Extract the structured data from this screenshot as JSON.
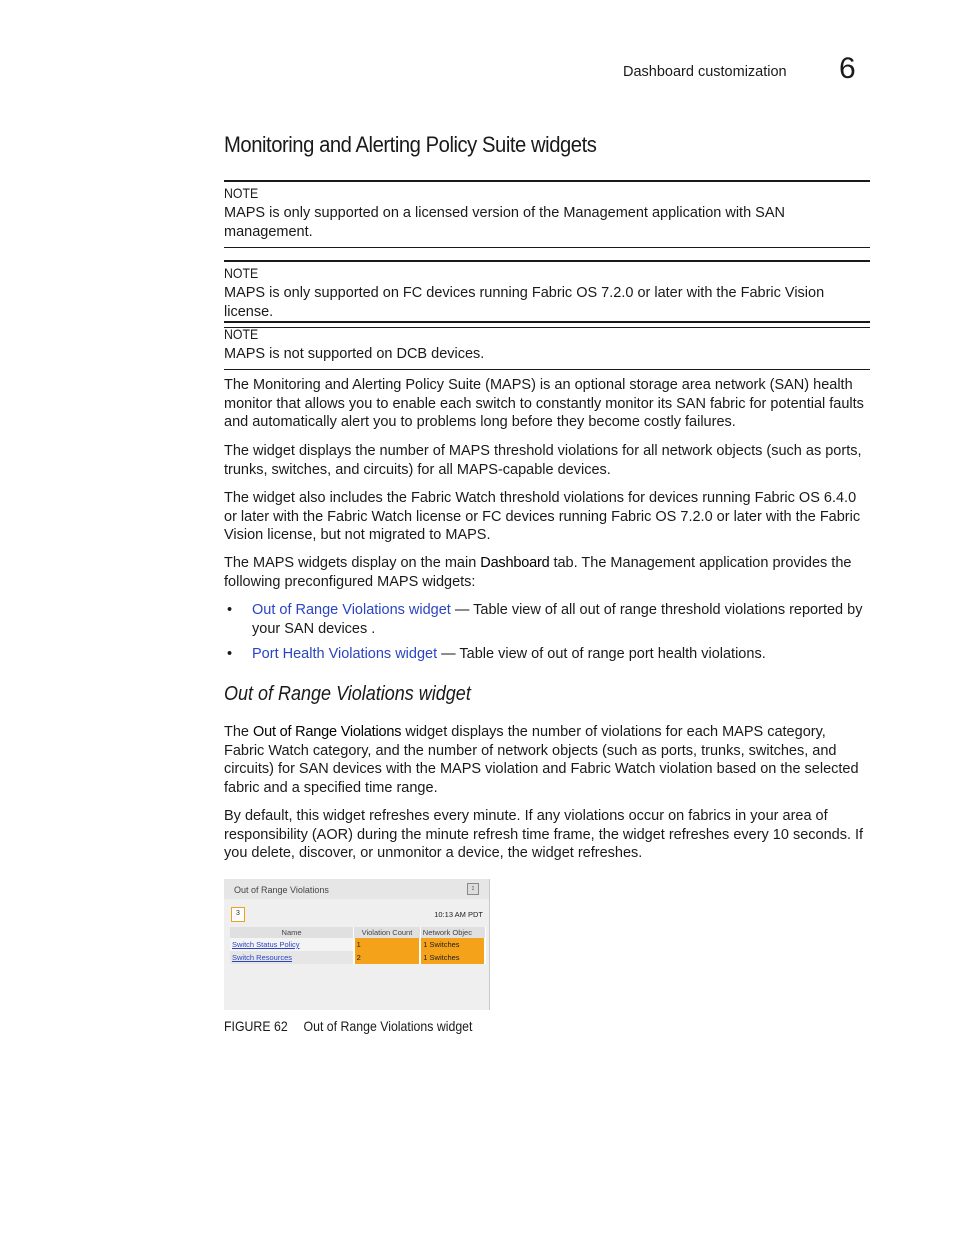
{
  "header": {
    "section": "Dashboard customization",
    "chapter": "6"
  },
  "title": "Monitoring and Alerting Policy Suite widgets",
  "notes": [
    {
      "label": "NOTE",
      "text": "MAPS is only supported on a licensed version of the Management application with SAN management."
    },
    {
      "label": "NOTE",
      "text": "MAPS is only supported on FC devices running Fabric OS 7.2.0 or later with the Fabric Vision license."
    },
    {
      "label": "NOTE",
      "text": "MAPS is not supported on DCB devices."
    }
  ],
  "paragraphs": {
    "p1": "The Monitoring and Alerting Policy Suite (MAPS) is an optional storage area network (SAN) health monitor that allows you to enable each switch to constantly monitor its SAN fabric for potential faults and automatically alert you to problems long before they become costly failures.",
    "p2": "The widget displays the number of MAPS threshold violations for all network objects (such as ports, trunks, switches, and circuits) for all MAPS-capable devices.",
    "p3": "The widget also includes the Fabric Watch threshold violations for devices running Fabric OS 6.4.0 or later with the Fabric Watch license or FC devices running Fabric OS 7.2.0 or later with the Fabric Vision license, but not migrated to MAPS.",
    "p4_pre": "The MAPS widgets display on the main ",
    "p4_bold": "Dashboard",
    "p4_post": " tab. The Management application provides the following preconfigured MAPS widgets:"
  },
  "bullets": [
    {
      "link": "Out of Range Violations widget",
      "text": " — Table view of all out of range threshold violations reported by your SAN devices ."
    },
    {
      "link": "Port Health Violations widget",
      "text": " — Table view of out of range port health violations."
    }
  ],
  "subsection": {
    "title": "Out of Range Violations widget",
    "p1_pre": "The ",
    "p1_bold": "Out of Range Violations",
    "p1_post": " widget displays the number of violations for each MAPS category, Fabric Watch category, and the number of network objects (such as ports, trunks, switches, and circuits) for SAN devices with the MAPS violation and Fabric Watch violation based on the selected fabric and a specified time range.",
    "p2": "By default, this widget refreshes every minute. If any violations occur on fabrics in your area of responsibility (AOR) during the minute refresh time frame, the widget refreshes every 10 seconds. If you delete, discover, or unmonitor a device, the widget refreshes."
  },
  "widget": {
    "title": "Out of Range Violations",
    "menu_icon": "↕",
    "badge": "3",
    "time": "10:13 AM PDT",
    "columns": [
      "Name",
      "Violation Count",
      "Network Objec"
    ],
    "rows": [
      {
        "name": "Switch Status Policy",
        "count": "1",
        "objects": "1 Switches"
      },
      {
        "name": "Switch Resources",
        "count": "2",
        "objects": "1 Switches"
      }
    ],
    "accent_color": "#f5a21b"
  },
  "caption": {
    "figure": "FIGURE 62",
    "text": "Out of Range Violations widget"
  }
}
